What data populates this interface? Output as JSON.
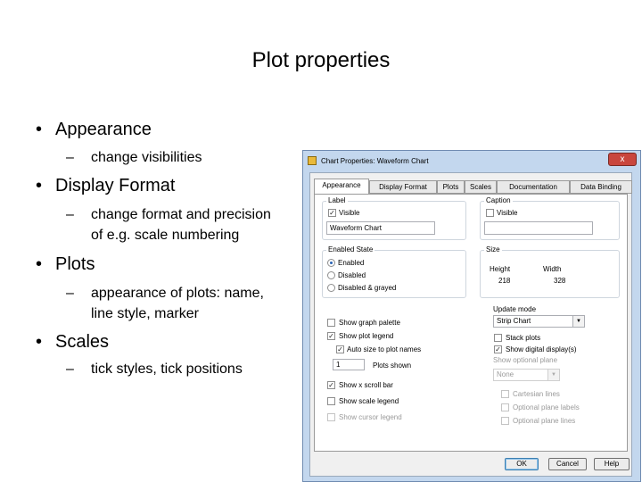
{
  "slide": {
    "title": "Plot properties",
    "bullets": [
      {
        "text": "Appearance",
        "sub": [
          "change visibilities"
        ]
      },
      {
        "text": "Display Format",
        "sub": [
          "change format and precision",
          "of e.g. scale numbering"
        ]
      },
      {
        "text": "Plots",
        "sub": [
          "appearance of plots: name,",
          "line style, marker"
        ]
      },
      {
        "text": "Scales",
        "sub": [
          "tick styles, tick positions"
        ]
      }
    ],
    "bullet_glyph": "•",
    "dash_glyph": "–"
  },
  "dialog": {
    "title": "Chart Properties: Waveform Chart",
    "close_glyph": "x",
    "tabs": [
      "Appearance",
      "Display Format",
      "Plots",
      "Scales",
      "Documentation",
      "Data Binding"
    ],
    "active_tab": "Appearance",
    "label_group": {
      "title": "Label",
      "visible_label": "Visible",
      "visible_checked": true,
      "value": "Waveform Chart"
    },
    "caption_group": {
      "title": "Caption",
      "visible_label": "Visible",
      "visible_checked": false,
      "value": ""
    },
    "enabled_state": {
      "title": "Enabled State",
      "options": [
        "Enabled",
        "Disabled",
        "Disabled & grayed"
      ],
      "selected": "Enabled"
    },
    "size": {
      "title": "Size",
      "height_label": "Height",
      "width_label": "Width",
      "height": "218",
      "width": "328"
    },
    "left_options": {
      "show_graph_palette": "Show graph palette",
      "show_plot_legend": "Show plot legend",
      "auto_size": "Auto size to plot names",
      "plots_shown_value": "1",
      "plots_shown_label": "Plots shown",
      "show_x_scrollbar": "Show x scroll bar",
      "show_scale_legend": "Show scale legend",
      "show_cursor_legend": "Show cursor legend"
    },
    "right_options": {
      "update_mode_label": "Update mode",
      "update_mode_value": "Strip Chart",
      "stack_plots": "Stack plots",
      "show_digital_display": "Show digital display(s)",
      "show_optional_plane": "Show optional plane",
      "optional_plane_value": "None",
      "cartesian_lines": "Cartesian lines",
      "optional_plane_labels": "Optional plane labels",
      "optional_plane_lines": "Optional plane lines"
    },
    "buttons": {
      "ok": "OK",
      "cancel": "Cancel",
      "help": "Help"
    },
    "check_glyph": "✓",
    "arrow_glyph": "▼"
  }
}
